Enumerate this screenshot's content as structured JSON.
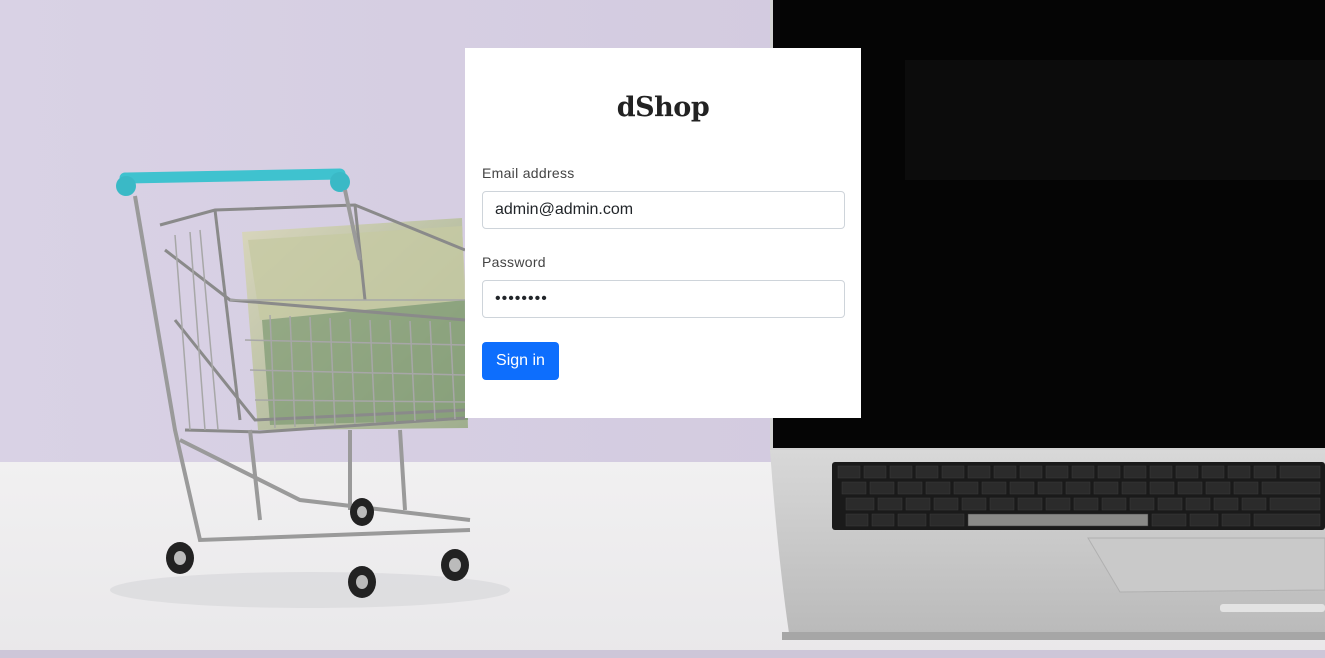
{
  "login": {
    "brand": "dShop",
    "email_label": "Email address",
    "email_value": "admin@admin.com",
    "password_label": "Password",
    "password_value": "password",
    "signin_label": "Sign in"
  },
  "colors": {
    "primary_button": "#0d6efd",
    "card_background": "#ffffff",
    "wall": "#d6cfe2",
    "table": "#efefef",
    "laptop_screen": "#050505"
  }
}
